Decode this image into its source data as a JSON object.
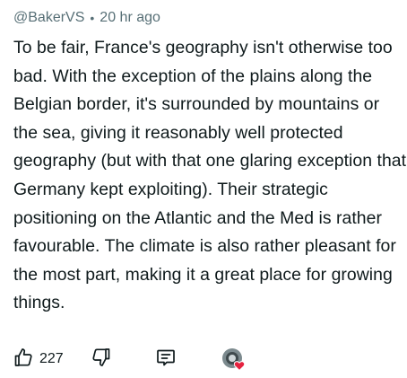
{
  "comment": {
    "author": "@BakerVS",
    "separator": "•",
    "timestamp": "20 hr ago",
    "body": "To be fair, France's geography isn't otherwise too bad. With the exception of the plains along the Belgian border, it's surrounded by mountains or the sea, giving it reasonably well protected geography (but with that one glaring exception that Germany kept exploiting). Their strategic positioning on the Atlantic and the Med is rather favourable. The climate is also rather pleasant for the most part, making it a great place for growing things."
  },
  "actions": {
    "upvote_count": "227",
    "icons": {
      "upvote": "thumbs-up-icon",
      "downvote": "thumbs-down-icon",
      "reply": "reply-bubble-icon",
      "award": "award-icon"
    }
  },
  "colors": {
    "text": "#0f1a1c",
    "meta": "#576f76",
    "heart": "#e5223f"
  }
}
